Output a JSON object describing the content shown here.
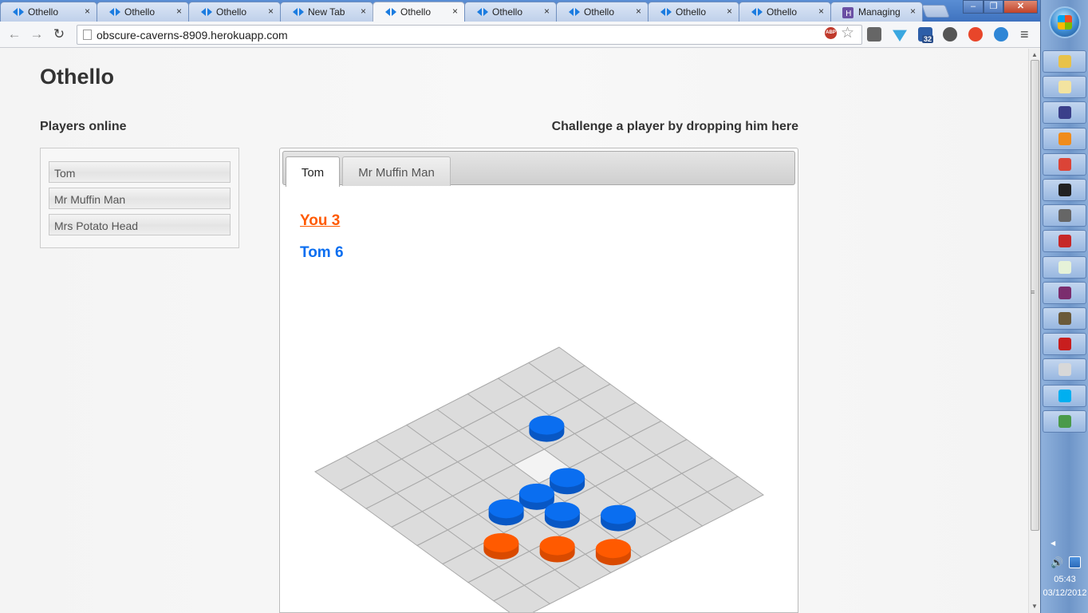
{
  "browser": {
    "tabs": [
      {
        "label": "Othello",
        "active": false
      },
      {
        "label": "Othello",
        "active": false
      },
      {
        "label": "Othello",
        "active": false
      },
      {
        "label": "New Tab",
        "active": false
      },
      {
        "label": "Othello",
        "active": true
      },
      {
        "label": "Othello",
        "active": false
      },
      {
        "label": "Othello",
        "active": false
      },
      {
        "label": "Othello",
        "active": false
      },
      {
        "label": "Othello",
        "active": false
      },
      {
        "label": "Managing",
        "active": false
      }
    ],
    "tab_close_glyph": "×",
    "url": "obscure-caverns-8909.herokuapp.com",
    "extension_badge": "32",
    "abp_label": "ABP"
  },
  "page": {
    "title": "Othello",
    "players_heading": "Players online",
    "challenge_heading": "Challenge a player by dropping him here",
    "players": [
      "Tom",
      "Mr Muffin Man",
      "Mrs Potato Head"
    ]
  },
  "game": {
    "tabs": [
      {
        "label": "Tom",
        "active": true
      },
      {
        "label": "Mr Muffin Man",
        "active": false
      }
    ],
    "score_you": "You 3",
    "score_opponent": "Tom 6",
    "colors": {
      "you": "#ff5a00",
      "opponent": "#0a6ef0",
      "board_cell": "#dcdcdc",
      "highlight_cell": "#f3f3f3"
    },
    "board": {
      "size": 8,
      "highlighted_cells": [
        [
          3,
          3
        ]
      ],
      "pieces": [
        {
          "row": 2,
          "col": 2,
          "owner": "opponent"
        },
        {
          "row": 3,
          "col": 4,
          "owner": "opponent"
        },
        {
          "row": 3,
          "col": 6,
          "owner": "opponent"
        },
        {
          "row": 4,
          "col": 4,
          "owner": "opponent"
        },
        {
          "row": 4,
          "col": 5,
          "owner": "opponent"
        },
        {
          "row": 5,
          "col": 4,
          "owner": "opponent"
        },
        {
          "row": 4,
          "col": 7,
          "owner": "you"
        },
        {
          "row": 5,
          "col": 6,
          "owner": "you"
        },
        {
          "row": 6,
          "col": 5,
          "owner": "you"
        }
      ]
    }
  },
  "taskbar": {
    "apps": [
      "explorer",
      "notepad",
      "eclipse",
      "vlc",
      "chrome",
      "cmd",
      "settings",
      "filezilla",
      "notes",
      "winrar",
      "ide",
      "acrobat",
      "file",
      "skype",
      "paint"
    ],
    "time": "05:43",
    "date": "03/12/2012"
  }
}
